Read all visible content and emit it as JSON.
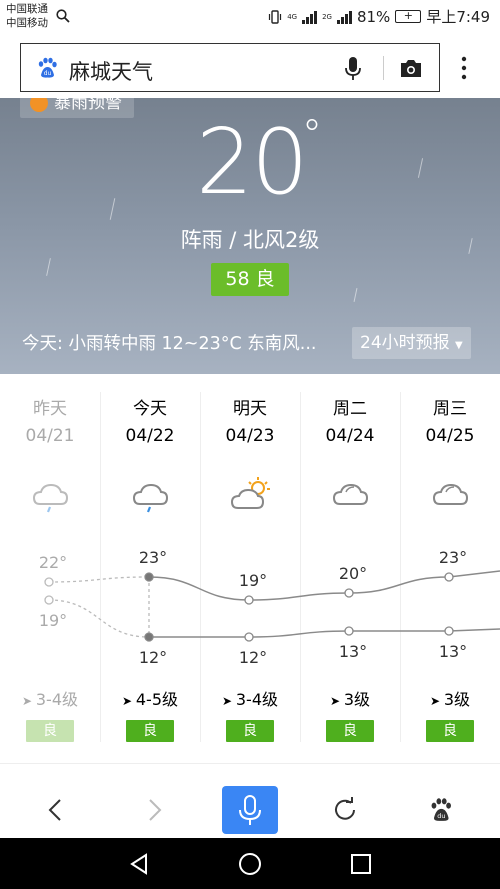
{
  "status": {
    "carrier1": "中国联通",
    "carrier2": "中国移动",
    "net1": "4G",
    "net2": "2G",
    "battery": "81%",
    "time": "早上7:49"
  },
  "search": {
    "query": "麻城天气"
  },
  "hero": {
    "alert": "暴雨预警",
    "temperature": "20",
    "degree": "°",
    "condition": "阵雨 / 北风2级",
    "aqi": "58 良",
    "today_summary": "今天: 小雨转中雨  12~23°C  东南风...",
    "forecast_button": "24小时预报",
    "colors": {
      "aqi": "#6bbd2a",
      "alert_icon": "#f29226"
    }
  },
  "forecast": {
    "days": [
      {
        "name": "昨天",
        "date": "04/21",
        "icon": "light-rain-icon",
        "high": "22°",
        "low": "19°",
        "wind": "3-4级",
        "aq": "良",
        "past": true
      },
      {
        "name": "今天",
        "date": "04/22",
        "icon": "light-rain-icon",
        "high": "23°",
        "low": "12°",
        "wind": "4-5级",
        "aq": "良",
        "past": false
      },
      {
        "name": "明天",
        "date": "04/23",
        "icon": "partly-cloudy-icon",
        "high": "19°",
        "low": "12°",
        "wind": "3-4级",
        "aq": "良",
        "past": false
      },
      {
        "name": "周二",
        "date": "04/24",
        "icon": "cloudy-icon",
        "high": "20°",
        "low": "13°",
        "wind": "3级",
        "aq": "良",
        "past": false
      },
      {
        "name": "周三",
        "date": "04/25",
        "icon": "cloudy-icon",
        "high": "23°",
        "low": "13°",
        "wind": "3级",
        "aq": "良",
        "past": false
      }
    ],
    "colors": {
      "aq": "#4faf1e",
      "line": "#8a8a8a"
    }
  },
  "chart_data": {
    "type": "line",
    "categories": [
      "04/21",
      "04/22",
      "04/23",
      "04/24",
      "04/25"
    ],
    "series": [
      {
        "values": [
          22,
          23,
          19,
          20,
          23
        ]
      },
      {
        "values": [
          19,
          12,
          12,
          13,
          13
        ]
      }
    ]
  },
  "bottom_bar": {
    "accent": "#3a86f4"
  }
}
